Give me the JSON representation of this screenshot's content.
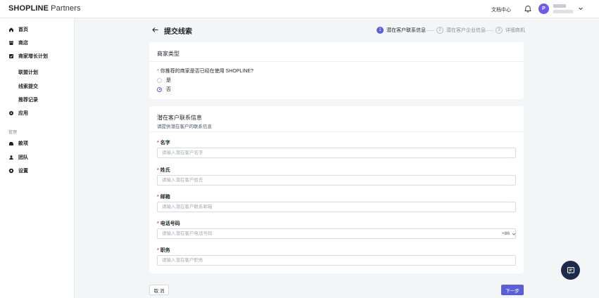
{
  "header": {
    "brand": "SHOPLINE",
    "brand_sub": " Partners",
    "doc_center": "文档中心",
    "avatar_initial": "P"
  },
  "sidebar": {
    "items": [
      {
        "label": "首页",
        "icon": "home-icon"
      },
      {
        "label": "商店",
        "icon": "store-icon"
      },
      {
        "label": "商家增长计划",
        "icon": "growth-plan-icon"
      }
    ],
    "sub_items": [
      "联盟计划",
      "线索提交",
      "推荐记录"
    ],
    "apps": {
      "label": "应用",
      "icon": "apps-icon"
    },
    "section_label": "管理",
    "manage_items": [
      {
        "label": "款项",
        "icon": "payments-icon"
      },
      {
        "label": "团队",
        "icon": "team-icon"
      },
      {
        "label": "设置",
        "icon": "settings-icon"
      }
    ]
  },
  "page": {
    "title": "提交线索",
    "steps": [
      {
        "num": "1",
        "label": "潜在客户联系信息",
        "active": true
      },
      {
        "num": "2",
        "label": "潜在客户企业信息",
        "active": false
      },
      {
        "num": "3",
        "label": "详细商机",
        "active": false
      }
    ]
  },
  "merchant_card": {
    "title": "商家类型",
    "question": "你推荐的商家是否已经在使用 SHOPLINE?",
    "required_mark": "*",
    "options": [
      {
        "label": "是",
        "checked": false
      },
      {
        "label": "否",
        "checked": true
      }
    ]
  },
  "contact_card": {
    "title": "潜在客户联系信息",
    "subtitle": "请提供潜在客户的联系信息",
    "fields": [
      {
        "label": "名字",
        "placeholder": "请输入潜在客户名字"
      },
      {
        "label": "姓氏",
        "placeholder": "请输入潜在客户姓氏"
      },
      {
        "label": "邮箱",
        "placeholder": "请输入潜在客户联系邮箱"
      },
      {
        "label": "电话号码",
        "placeholder": "请输入潜在客户电话号码",
        "country_code": "+86"
      },
      {
        "label": "职务",
        "placeholder": "请输入潜在客户职务"
      }
    ]
  },
  "footer": {
    "cancel": "取 消",
    "next": "下一步"
  },
  "colors": {
    "accent": "#5b5fd6",
    "required": "#e34d4d",
    "fab": "#1e2a4a"
  }
}
